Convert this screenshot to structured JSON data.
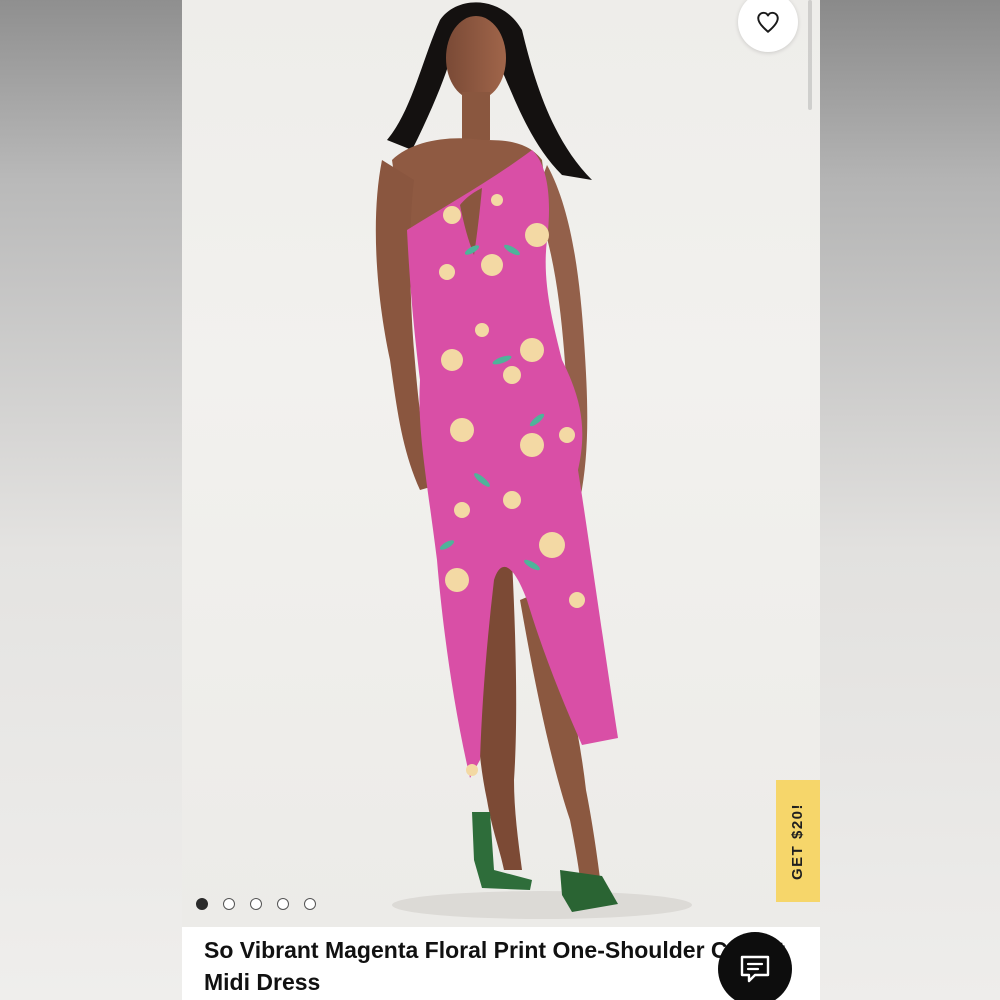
{
  "product": {
    "title": "So Vibrant Magenta Floral Print One-Shoulder Cutout Midi Dress",
    "image_alt": "Model wearing magenta floral print one-shoulder cutout midi dress"
  },
  "promo": {
    "label": "GET $20!"
  },
  "carousel": {
    "count": 5,
    "active_index": 0
  },
  "icons": {
    "wishlist": "heart-icon",
    "chat": "chat-bubble-icon"
  },
  "colors": {
    "dress": "#d94fa6",
    "promo_tab": "#f6d66a",
    "chat_button": "#0d0d0d"
  }
}
